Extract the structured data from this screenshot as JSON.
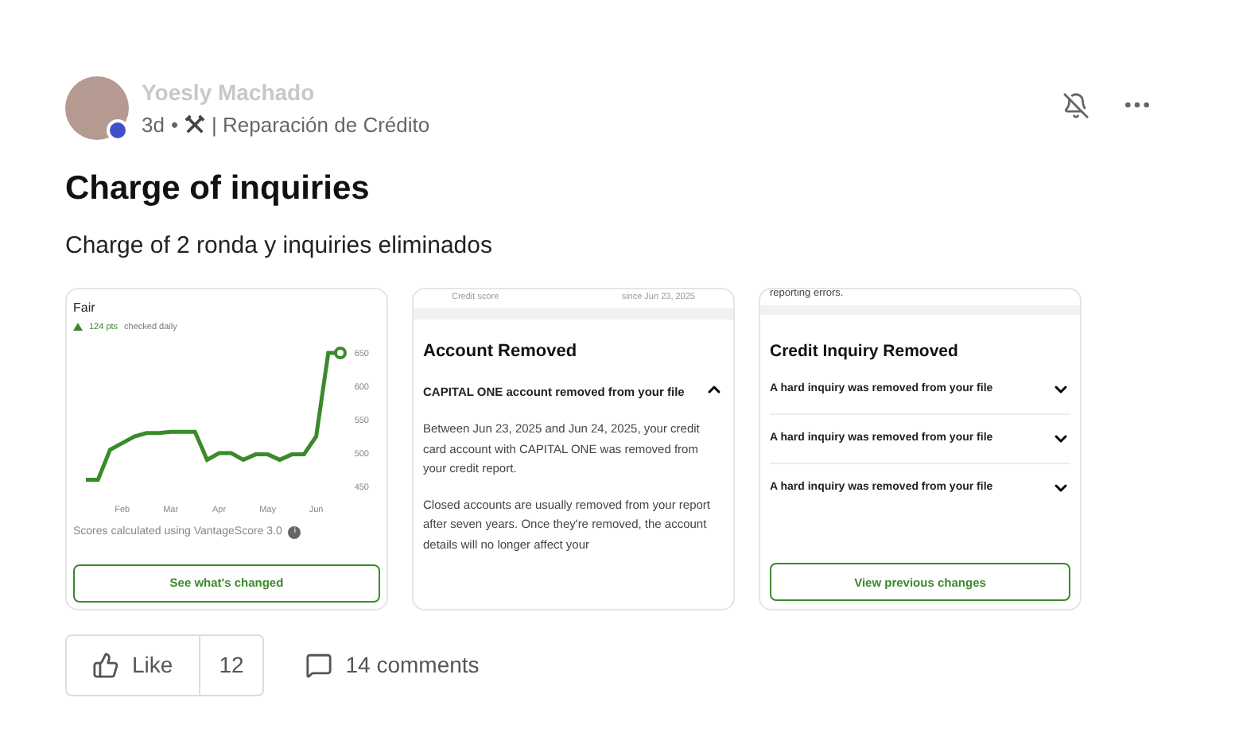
{
  "post": {
    "author": "Yoesly Machado",
    "age": "3d",
    "separator": "•",
    "group": "| Reparación de Crédito",
    "title": "Charge of inquiries",
    "body": "Charge of 2 ronda y inquiries eliminados"
  },
  "images": [
    {
      "kind": "score",
      "heading": "Fair",
      "change": "124 pts",
      "change_note": "checked daily",
      "chart_data": {
        "type": "line",
        "categories": [
          null,
          null,
          null,
          "Feb",
          null,
          null,
          null,
          "Mar",
          null,
          null,
          null,
          "Apr",
          null,
          null,
          null,
          "May",
          null,
          null,
          null,
          "Jun",
          null,
          null
        ],
        "yticks": [
          450,
          500,
          550,
          600,
          650
        ],
        "ylim": [
          450,
          650
        ],
        "series": [
          {
            "color": "#3a8a2a",
            "values": [
              460,
              460,
              505,
              515,
              525,
              530,
              530,
              532,
              532,
              532,
              490,
              500,
              500,
              490,
              498,
              498,
              490,
              498,
              498,
              525,
              650,
              650
            ]
          }
        ]
      },
      "footer": "Scores calculated using VantageScore 3.0",
      "info": "i",
      "button": "See what's changed"
    },
    {
      "kind": "account",
      "top_left": "Credit score",
      "top_right": "since Jun 23, 2025",
      "heading": "Account Removed",
      "item": "CAPITAL ONE account removed from your file",
      "expanded": true,
      "paragraphs": [
        "Between Jun 23, 2025 and Jun 24, 2025, your credit card account with CAPITAL ONE was removed from your credit report.",
        "Closed accounts are usually removed from your report after seven years. Once they're removed, the account details will no longer affect your"
      ]
    },
    {
      "kind": "inquiry",
      "top": "reporting errors.",
      "heading": "Credit Inquiry Removed",
      "items": [
        {
          "label": "A hard inquiry was removed from your file",
          "expanded": false
        },
        {
          "label": "A hard inquiry was removed from your file",
          "expanded": false
        },
        {
          "label": "A hard inquiry was removed from your file",
          "expanded": false
        }
      ],
      "button": "View previous changes"
    }
  ],
  "actions": {
    "like": "Like",
    "like_count": "12",
    "comments": "14 comments"
  }
}
